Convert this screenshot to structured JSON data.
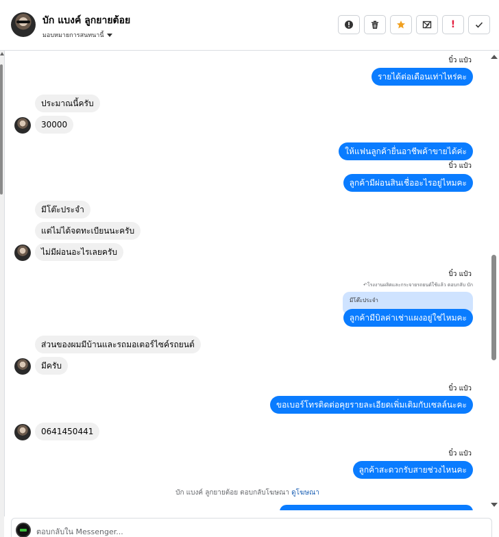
{
  "header": {
    "contact_name": "บัก แบงค์ ลูกยายต้อย",
    "assign_label": "มอบหมายการสนทนานี้",
    "actions": [
      {
        "name": "report-button",
        "icon": "alert-circle-icon",
        "glyph": "!"
      },
      {
        "name": "delete-button",
        "icon": "trash-icon"
      },
      {
        "name": "star-button",
        "icon": "star-icon",
        "glyph": "★"
      },
      {
        "name": "move-to-inbox-button",
        "icon": "mail-x-icon"
      },
      {
        "name": "priority-button",
        "icon": "exclamation-icon",
        "glyph": "!"
      },
      {
        "name": "mark-done-button",
        "icon": "check-icon",
        "glyph": "✓"
      }
    ]
  },
  "messages": {
    "m1_sender": "บิ๋ว แป๋ว",
    "m1": "รายได้ต่อเดือนเท่าไหร่คะ",
    "m2": "ประมาณนี้ครับ",
    "m3": "30000",
    "m4": "ให้แฟนลูกค้ายื่นอาชีพค้าขายได้ค่ะ",
    "m5_sender": "บิ๋ว แป๋ว",
    "m5": "ลูกค้ามีผ่อนสินเชื่ออะไรอยู่ไหมคะ",
    "m6": "มีโต๊ะประจำ",
    "m7": "แต่ไม่ได้จดทะเบียนนะครับ",
    "m8": "ไม่มีผ่อนอะไรเลยครับ",
    "m9_sender": "บิ๋ว แป๋ว",
    "m9_reply_note": "↶โรงงานผลิตและกระจายรถยนต์ใช้แล้ว ตอบกลับ บัก",
    "m9_quote": "มีโต๊ะประจำ",
    "m9": "ลูกค้ามีบิลค่าเช่าแผงอยู่ใช่ไหมคะ",
    "m10": "ส่วนของผมมีบ้านและรถมอเตอร์ไซค์รถยนต์",
    "m11": "มีครับ",
    "m12_sender": "บิ๋ว แป๋ว",
    "m12": "ขอเบอร์โทรติดต่อคุยรายละเอียดเพิ่มเติมกับเซลล์นะคะ",
    "m13": "0641450441",
    "m14_sender": "บิ๋ว แป๋ว",
    "m14": "ลูกค้าสะดวกรับสายช่วงไหนคะ",
    "ad_reply_text": "บัก แบงค์ ลูกยายต้อย ตอบกลับโฆษณา",
    "ad_reply_link": "ดูโฆษณา"
  },
  "composer": {
    "placeholder": "ตอบกลับใน Messenger..."
  },
  "colors": {
    "outgoing": "#0a7cff",
    "incoming": "#f0f0f0",
    "quote": "#cfe3ff",
    "star": "#f0a020",
    "danger": "#e41e3f"
  }
}
